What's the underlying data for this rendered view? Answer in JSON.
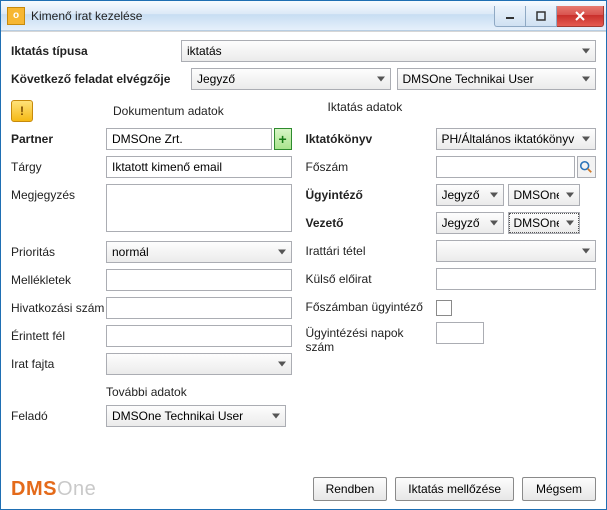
{
  "window": {
    "title": "Kimenő irat kezelése"
  },
  "topRows": {
    "iktatasTipusa": {
      "label": "Iktatás típusa",
      "value": "iktatás"
    },
    "kovetkezoFeladat": {
      "label": "Következő feladat elvégzője",
      "role": "Jegyző",
      "user": "DMSOne Technikai User"
    }
  },
  "sections": {
    "documentHeading": "Dokumentum adatok",
    "iktatasHeading": "Iktatás adatok",
    "additionalHeading": "További adatok"
  },
  "doc": {
    "partnerLabel": "Partner",
    "partner": "DMSOne Zrt.",
    "targyLabel": "Tárgy",
    "targy": "Iktatott kimenő email",
    "megjegyzesLabel": "Megjegyzés",
    "megjegyzes": "",
    "prioritasLabel": "Prioritás",
    "prioritas": "normál",
    "mellekletekLabel": "Mellékletek",
    "mellekletek": "",
    "hivatkozasLabel": "Hivatkozási szám",
    "hivatkozas": "",
    "erintettFelLabel": "Érintett fél",
    "erintettFel": "",
    "iratFajtaLabel": "Irat fajta",
    "iratFajta": ""
  },
  "ikt": {
    "konyvLabel": "Iktatókönyv",
    "konyv": "PH/Általános iktatókönyv",
    "foszamLabel": "Főszám",
    "foszam": "",
    "ugyintezoLabel": "Ügyintéző",
    "ugyintezoRole": "Jegyző",
    "ugyintezoUser": "DMSOne",
    "vezetoLabel": "Vezető",
    "vezetoRole": "Jegyző",
    "vezetoUser": "DMSOne",
    "irattariLabel": "Irattári tétel",
    "irattari": "",
    "kulsoLabel": "Külső előirat",
    "kulso": "",
    "foszamUgyintezoLabel": "Főszámban ügyintéző",
    "foszamUgyintezoChecked": false,
    "napokLabel": "Ügyintézési napok szám",
    "napok": ""
  },
  "additional": {
    "feladoLabel": "Feladó",
    "felado": "DMSOne Technikai User"
  },
  "buttons": {
    "ok": "Rendben",
    "skip": "Iktatás mellőzése",
    "cancel": "Mégsem"
  },
  "logo": {
    "brand": "DMS",
    "accent": "One"
  }
}
